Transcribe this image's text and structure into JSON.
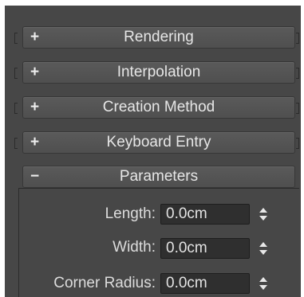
{
  "rollouts": [
    {
      "label": "Rendering",
      "state": "+"
    },
    {
      "label": "Interpolation",
      "state": "+"
    },
    {
      "label": "Creation Method",
      "state": "+"
    },
    {
      "label": "Keyboard Entry",
      "state": "+"
    },
    {
      "label": "Parameters",
      "state": "−"
    }
  ],
  "parameters": {
    "length": {
      "label": "Length:",
      "value": "0.0cm"
    },
    "width": {
      "label": "Width:",
      "value": "0.0cm"
    },
    "corner_radius": {
      "label": "Corner Radius:",
      "value": "0.0cm"
    }
  }
}
